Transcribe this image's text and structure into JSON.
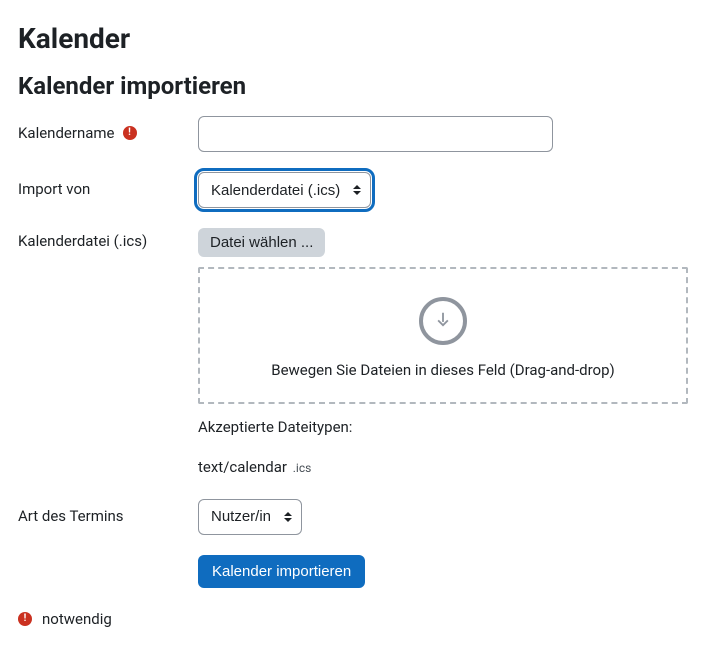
{
  "header": {
    "title": "Kalender",
    "subtitle": "Kalender importieren"
  },
  "form": {
    "calendar_name": {
      "label": "Kalendername",
      "value": ""
    },
    "import_from": {
      "label": "Import von",
      "selected": "Kalenderdatei (.ics)"
    },
    "calendar_file": {
      "label": "Kalenderdatei (.ics)",
      "button": "Datei wählen ...",
      "dropzone_text": "Bewegen Sie Dateien in dieses Feld (Drag-and-drop)",
      "accepted_label": "Akzeptierte Dateitypen:",
      "accepted_type": "text/calendar",
      "accepted_ext": ".ics"
    },
    "event_type": {
      "label": "Art des Termins",
      "selected": "Nutzer/in"
    },
    "submit_label": "Kalender importieren"
  },
  "legend": {
    "required_text": "notwendig"
  }
}
